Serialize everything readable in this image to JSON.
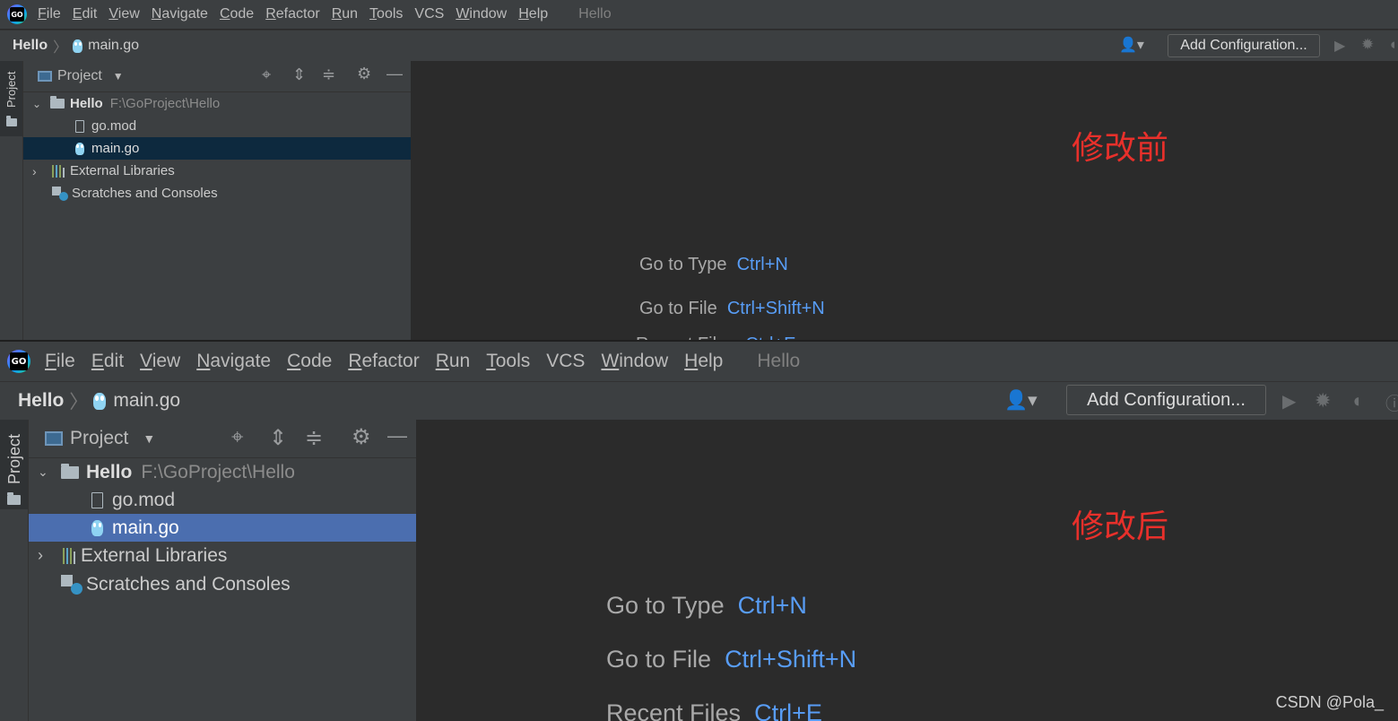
{
  "menu": {
    "items": [
      "File",
      "Edit",
      "View",
      "Navigate",
      "Code",
      "Refactor",
      "Run",
      "Tools",
      "VCS",
      "Window",
      "Help"
    ],
    "mnemonic_first": [
      "F",
      "E",
      "V",
      "N",
      "C",
      "R",
      "R",
      "T",
      "",
      "W",
      "H"
    ],
    "mnemonic_rest": [
      "ile",
      "dit",
      "iew",
      "avigate",
      "ode",
      "efactor",
      "un",
      "ools",
      "VCS",
      "indow",
      "elp"
    ],
    "app_title": "Hello",
    "logo_text": "GO"
  },
  "breadcrumb": {
    "root": "Hello",
    "file": "main.go"
  },
  "toolbar": {
    "add_configuration": "Add Configuration...",
    "icons": [
      "user-icon",
      "run-icon",
      "debug-icon",
      "coverage-icon"
    ]
  },
  "left_strip": {
    "tab_label": "Project"
  },
  "project_panel": {
    "title": "Project",
    "tree": {
      "root_name": "Hello",
      "root_path": "F:\\GoProject\\Hello",
      "children": [
        "go.mod",
        "main.go"
      ],
      "external_libraries": "External Libraries",
      "scratches": "Scratches and Consoles"
    }
  },
  "editor_hints": [
    {
      "label": "Go to Type",
      "shortcut": "Ctrl+N"
    },
    {
      "label": "Go to File",
      "shortcut": "Ctrl+Shift+N"
    },
    {
      "label": "Recent Files",
      "shortcut": "Ctrl+E"
    }
  ],
  "annotations": {
    "before": "修改前",
    "after": "修改后"
  },
  "watermark": "CSDN @Pola_",
  "colors": {
    "accent_blue": "#589df6",
    "annotation_red": "#e8302b",
    "selection_old": "#0d293e",
    "selection_new": "#4b6eaf"
  }
}
